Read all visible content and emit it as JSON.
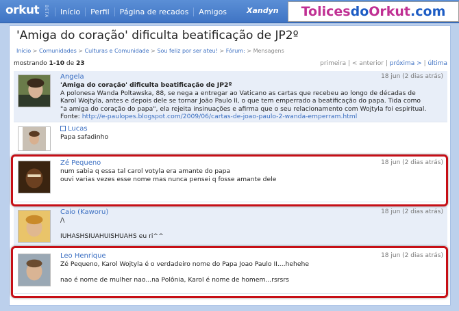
{
  "topbar": {
    "logo": "orkut",
    "beta": "BETA",
    "nav": [
      "Início",
      "Perfil",
      "Página de recados",
      "Amigos"
    ],
    "user": "Xandyn",
    "brand_a": "Tolices",
    "brand_b": "do",
    "brand_c": "Orkut",
    "brand_d": ".com"
  },
  "page": {
    "title": "'Amiga do coração' dificulta beatificação de JP2º",
    "breadcrumb": [
      "Início",
      "Comunidades",
      "Culturas e Comunidade",
      "Sou feliz por ser ateu!",
      "Fórum:",
      "Mensagens"
    ],
    "showing": "mostrando",
    "range": "1-10",
    "of": "de",
    "total": "23",
    "pager": [
      "primeira",
      "< anterior",
      "próxima >",
      "última"
    ]
  },
  "posts": [
    {
      "author": "Angela",
      "date": "18 jun (2 dias atrás)",
      "subject": "'Amiga do coração' dificulta beatificação de JP2º",
      "lines": [
        "A polonesa Wanda Poltawska, 88, se nega a entregar ao Vaticano as cartas que recebeu ao longo de décadas de",
        "Karol Wojtyla, antes e depois dele se tornar João Paulo II, o que tem emperrado a beatificação do papa. Tida como",
        "\"a amiga do coração do papa\", ela rejeita insinuações e afirma que o seu relacionamento com Wojtyla foi espiritual."
      ],
      "source_label": "Fonte:",
      "source_url": "http://e-paulopes.blogspot.com/2009/06/cartas-de-joao-paulo-2-wanda-emperram.html"
    },
    {
      "author": "Lucas",
      "date": "",
      "lines": [
        "Papa safadinho"
      ]
    },
    {
      "author": "Zé Pequeno",
      "date": "18 jun (2 dias atrás)",
      "lines": [
        "num sabia q essa tal carol votyla era amante do papa",
        "ouvi varias vezes esse nome mas nunca pensei q fosse amante dele"
      ]
    },
    {
      "author": "Caio (Kaworu)",
      "date": "18 jun (2 dias atrás)",
      "lines": [
        "/\\",
        "",
        "IUHASHSIUAHUISHUAHS eu ri^^"
      ]
    },
    {
      "author": "Leo Henrique",
      "date": "18 jun (2 dias atrás)",
      "lines": [
        "Zé Pequeno, Karol Wojtyla é o verdadeiro nome do Papa Joao Paulo II....hehehe",
        "",
        "nao é nome de mulher nao...na Polônia, Karol é nome de homem...rsrsrs"
      ]
    }
  ],
  "colors": {
    "accent": "#3b6fc2",
    "highlight": "#c60f16",
    "brand_pink": "#c02f93",
    "brand_blue": "#1d5cc4"
  }
}
